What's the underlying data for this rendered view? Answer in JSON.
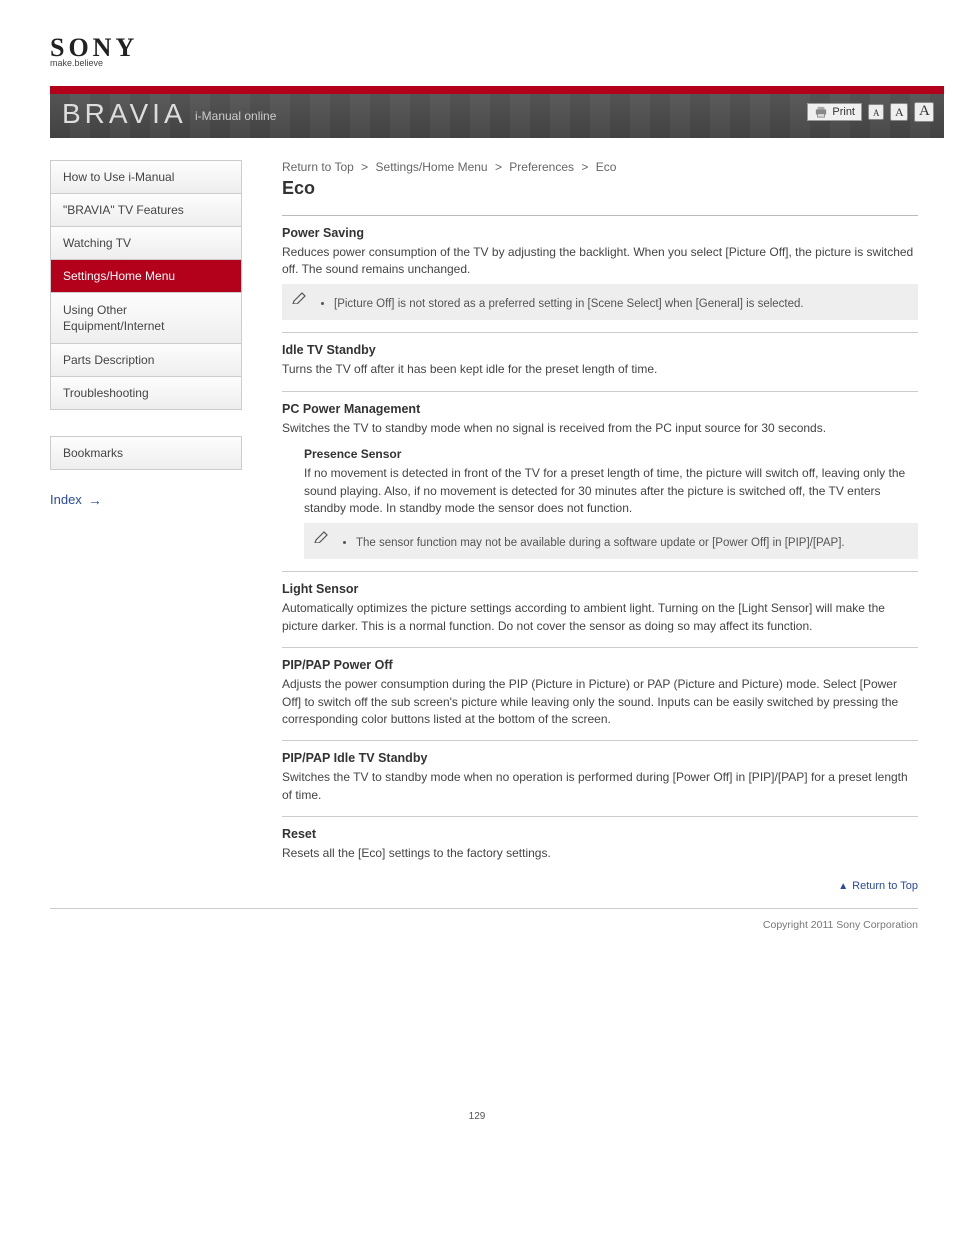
{
  "logo": {
    "brand": "SONY",
    "tagline": "make.believe"
  },
  "header": {
    "bravia": "BRAVIA",
    "i_manual_link": "i-Manual online",
    "print_label": "Print",
    "font_glyph": "A"
  },
  "nav": {
    "items": [
      {
        "label": "How to Use i-Manual"
      },
      {
        "label": "\"BRAVIA\" TV Features"
      },
      {
        "label": "Watching TV"
      },
      {
        "label": "Settings/Home Menu"
      },
      {
        "label": "Using Other Equipment/Internet"
      },
      {
        "label": "Parts Description"
      },
      {
        "label": "Troubleshooting"
      }
    ],
    "active_index": 3,
    "solo": "Bookmarks",
    "ext": "Index"
  },
  "breadcrumb": {
    "a": "Return to Top",
    "b": "Settings/Home Menu",
    "c": "Preferences",
    "d": "Eco",
    "sep": ">"
  },
  "title": "Eco",
  "sections": [
    {
      "title": "Power Saving",
      "body": "Reduces power consumption of the TV by adjusting the backlight. When you select [Picture Off], the picture is switched off. The sound remains unchanged.",
      "note_body": "[Picture Off] is not stored as a preferred setting in [Scene Select] when [General] is selected."
    },
    {
      "title": "Idle TV Standby",
      "body": "Turns the TV off after it has been kept idle for the preset length of time."
    },
    {
      "title": "PC Power Management",
      "body": "Switches the TV to standby mode when no signal is received from the PC input source for 30 seconds.",
      "sub": {
        "title": "Presence Sensor",
        "body": "If no movement is detected in front of the TV for a preset length of time, the picture will switch off, leaving only the sound playing. Also, if no movement is detected for 30 minutes after the picture is switched off, the TV enters standby mode. In standby mode the sensor does not function.",
        "note_body": "The sensor function may not be available during a software update or [Power Off] in [PIP]/[PAP]."
      }
    },
    {
      "title": "Light Sensor",
      "body": "Automatically optimizes the picture settings according to ambient light. Turning on the [Light Sensor] will make the picture darker. This is a normal function. Do not cover the sensor as doing so may affect its function."
    },
    {
      "title": "PIP/PAP Power Off",
      "body": "Adjusts the power consumption during the PIP (Picture in Picture) or PAP (Picture and Picture) mode. Select [Power Off] to switch off the sub screen's picture while leaving only the sound. Inputs can be easily switched by pressing the corresponding color buttons listed at the bottom of the screen."
    },
    {
      "title": "PIP/PAP Idle TV Standby",
      "body": "Switches the TV to standby mode when no operation is performed during [Power Off] in [PIP]/[PAP] for a preset length of time."
    },
    {
      "title": "Reset",
      "body": "Resets all the [Eco] settings to the factory settings."
    }
  ],
  "top_link": "Return to Top",
  "copyright": "Copyright 2011 Sony Corporation",
  "page_number": "129"
}
